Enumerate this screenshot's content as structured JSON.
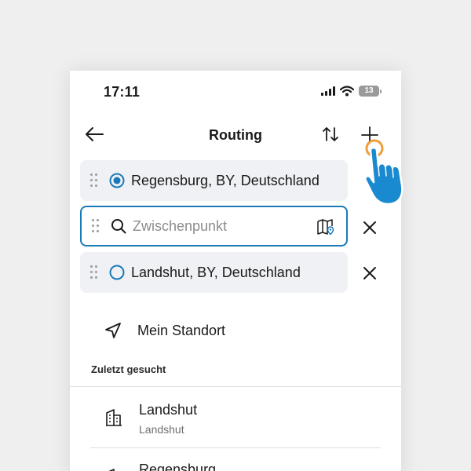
{
  "status_bar": {
    "time": "17:11",
    "battery": "13",
    "icons": [
      "signal-icon",
      "wifi-icon",
      "battery-icon"
    ]
  },
  "header": {
    "title": "Routing",
    "back_icon": "arrow-left-icon",
    "swap_icon": "swap-vertical-icon",
    "add_icon": "plus-icon"
  },
  "route": {
    "start": "Regensburg, BY, Deutschland",
    "waypoint_placeholder": "Zwischenpunkt",
    "waypoint_value": "",
    "destination": "Landshut, BY, Deutschland"
  },
  "my_location": {
    "label": "Mein Standort",
    "icon": "navigation-arrow-icon"
  },
  "recent": {
    "section_label": "Zuletzt gesucht",
    "items": [
      {
        "title": "Landshut",
        "subtitle": "Landshut",
        "icon": "building-icon"
      },
      {
        "title": "Regensburg",
        "subtitle": "",
        "icon": "building-icon"
      }
    ]
  },
  "colors": {
    "accent": "#1a7ab8",
    "row_background": "#f0f1f4",
    "hand": "#1a8ad0",
    "tap_indicator": "#f39c3a"
  }
}
